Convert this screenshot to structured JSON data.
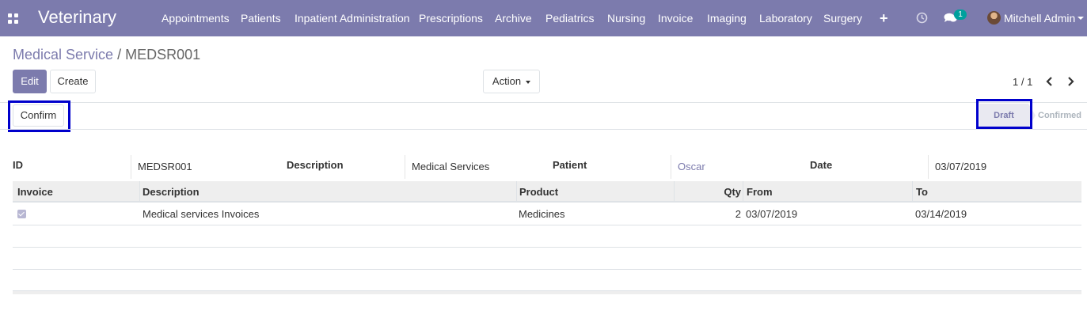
{
  "navbar": {
    "brand": "Veterinary",
    "menu": [
      "Appointments",
      "Patients",
      "Inpatient Administration",
      "Prescriptions",
      "Archive",
      "Pediatrics",
      "Nursing",
      "Invoice",
      "Imaging",
      "Laboratory",
      "Surgery"
    ],
    "messages_count": "1",
    "user_name": "Mitchell Admin",
    "icons": [
      "apps-grid-icon",
      "plus-icon",
      "clock-icon",
      "chat-icon",
      "avatar",
      "caret-down-icon"
    ],
    "color": "#7c7bad"
  },
  "breadcrumb": {
    "parent": "Medical Service",
    "separator": "/",
    "current": "MEDSR001"
  },
  "buttons": {
    "edit": "Edit",
    "create": "Create",
    "action": "Action",
    "confirm": "Confirm"
  },
  "pager": {
    "value": "1 / 1"
  },
  "status": {
    "stages": [
      "Draft",
      "Confirmed"
    ],
    "current": "Draft"
  },
  "form": {
    "id_label": "ID",
    "id_value": "MEDSR001",
    "description_label": "Description",
    "description_value": "Medical Services",
    "patient_label": "Patient",
    "patient_value": "Oscar",
    "date_label": "Date",
    "date_value": "03/07/2019"
  },
  "table": {
    "headers": [
      "Invoice",
      "Description",
      "Product",
      "Qty",
      "From",
      "To"
    ],
    "rows": [
      {
        "invoice": true,
        "description": "Medical services Invoices",
        "product": "Medicines",
        "qty": "2",
        "from": "03/07/2019",
        "to": "03/14/2019"
      }
    ]
  },
  "colors": {
    "accent": "#7c7bad",
    "highlight": "#0000cc",
    "badge": "#00a09d"
  }
}
